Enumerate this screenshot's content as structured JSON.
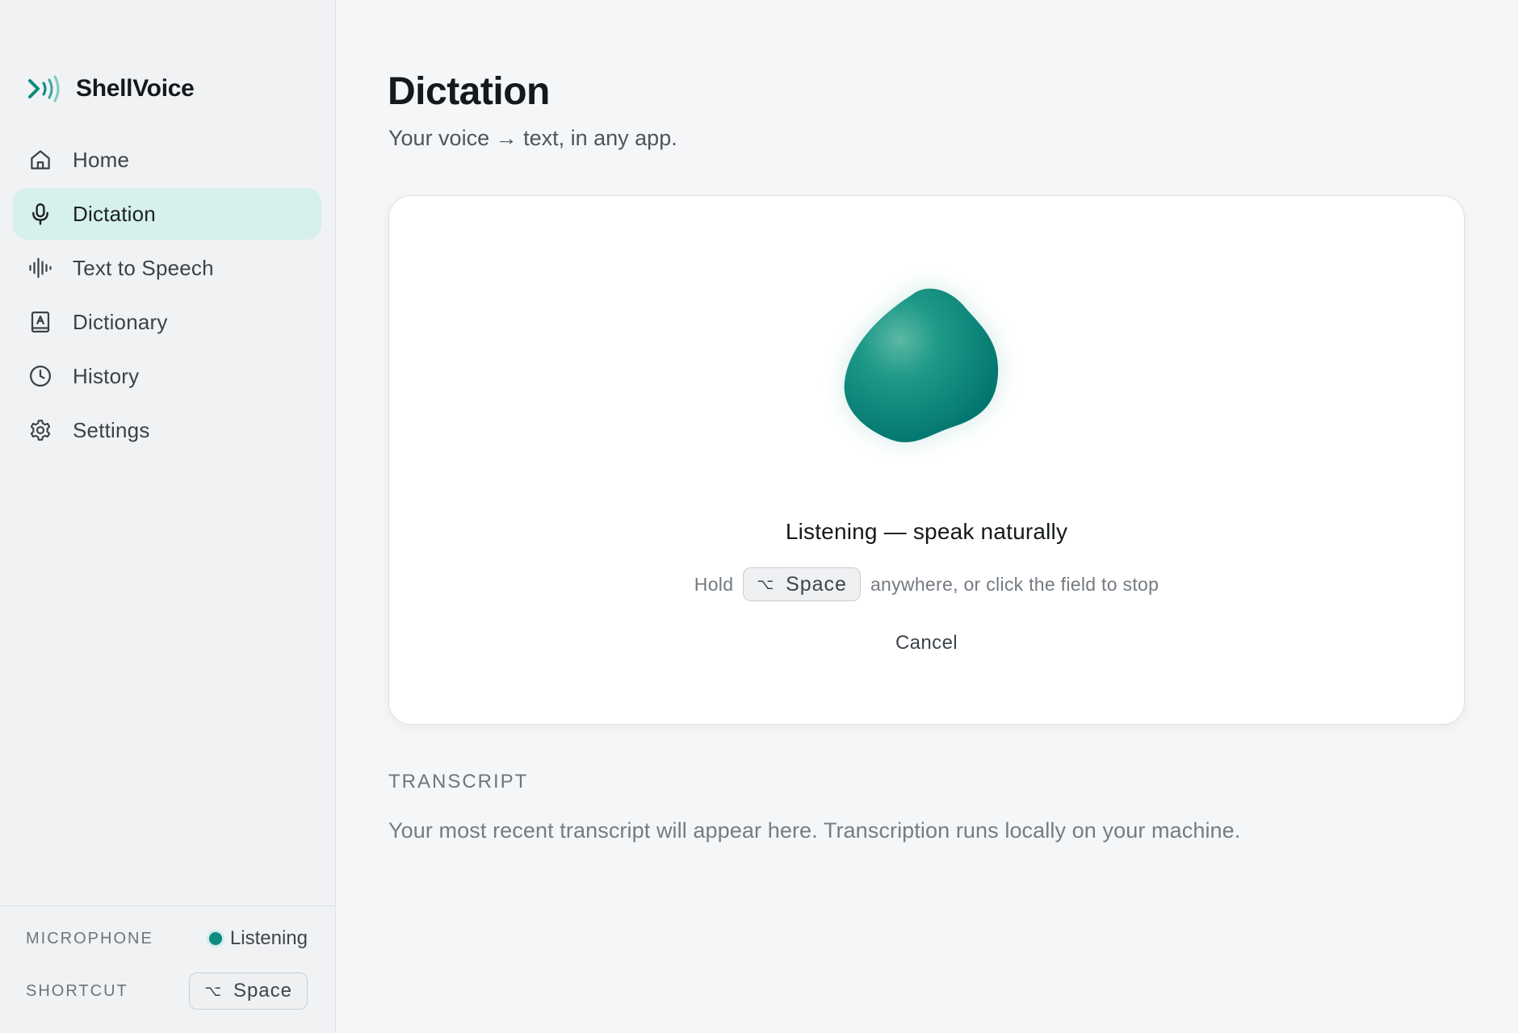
{
  "app": {
    "name": "ShellVoice"
  },
  "sidebar": {
    "items": [
      {
        "label": "Home",
        "icon": "home-icon"
      },
      {
        "label": "Dictation",
        "icon": "microphone-icon",
        "active": true
      },
      {
        "label": "Text to Speech",
        "icon": "waveform-icon"
      },
      {
        "label": "Dictionary",
        "icon": "book-icon"
      },
      {
        "label": "History",
        "icon": "clock-icon"
      },
      {
        "label": "Settings",
        "icon": "gear-icon"
      }
    ],
    "footer": {
      "microphone_label": "MICROPHONE",
      "microphone_status": "Listening",
      "shortcut_label": "SHORTCUT",
      "shortcut_key_symbol": "⌥",
      "shortcut_key": "Space"
    }
  },
  "main": {
    "title": "Dictation",
    "subtitle": "Your voice → text, in any app.",
    "card": {
      "status_title": "Listening — speak naturally",
      "hint_prefix": "Hold",
      "hint_key_symbol": "⌥",
      "hint_key": "Space",
      "hint_suffix": "anywhere, or click the field to stop",
      "cancel_label": "Cancel"
    },
    "transcript": {
      "label": "TRANSCRIPT",
      "placeholder": "Your most recent transcript will appear here. Transcription runs locally on your machine."
    }
  },
  "colors": {
    "accent": "#0e8a7f",
    "active_nav_bg": "#d6f0ec",
    "sidebar_bg": "#f0f2f4",
    "main_bg": "#f5f6f8"
  }
}
